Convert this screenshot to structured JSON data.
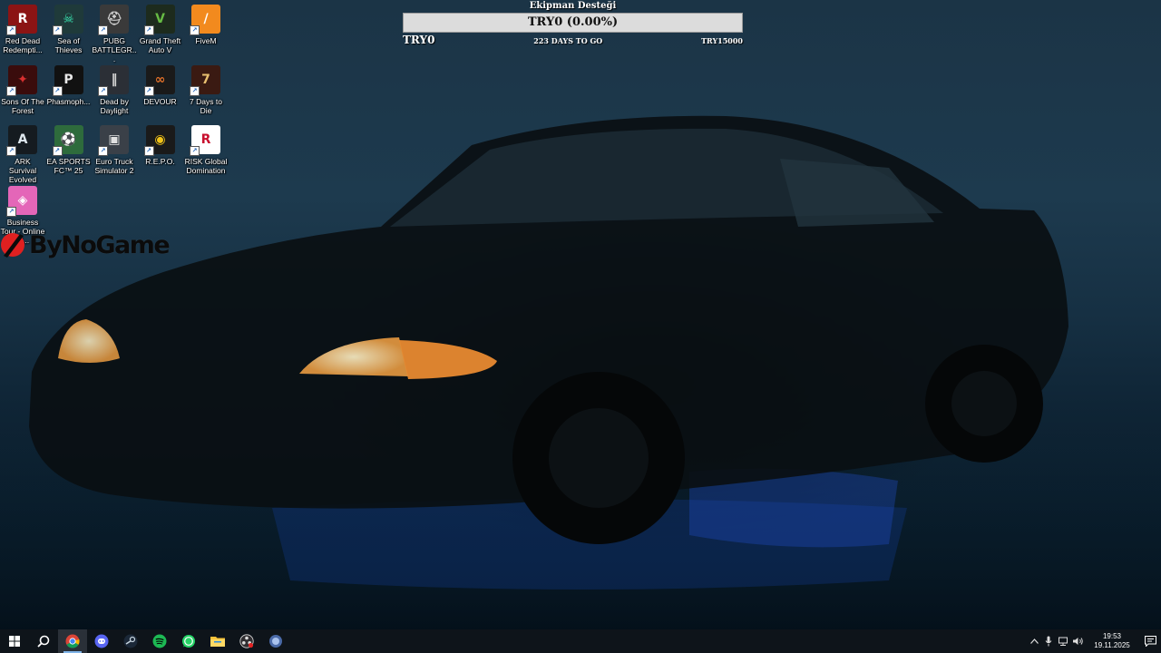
{
  "desktop": {
    "icons": [
      {
        "label": "Red Dead Redempti...",
        "glyph": "R",
        "bg": "#8b1414",
        "fg": "#ffffff",
        "icon": "red-dead-redemption-icon"
      },
      {
        "label": "Sea of Thieves",
        "glyph": "☠",
        "bg": "#1f3a3a",
        "fg": "#39e3b0",
        "icon": "sea-of-thieves-icon"
      },
      {
        "label": "PUBG BATTLEGR...",
        "glyph": "⛑",
        "bg": "#3a3a3a",
        "fg": "#d0d0d0",
        "icon": "pubg-icon"
      },
      {
        "label": "Grand Theft Auto V",
        "glyph": "V",
        "bg": "#1d2b1d",
        "fg": "#66bb44",
        "icon": "gta-v-icon"
      },
      {
        "label": "FiveM",
        "glyph": "/",
        "bg": "#f28a1e",
        "fg": "#ffffff",
        "icon": "fivem-icon"
      },
      {
        "label": "Sons Of The Forest",
        "glyph": "✦",
        "bg": "#3a0c0c",
        "fg": "#d83030",
        "icon": "sons-of-the-forest-icon"
      },
      {
        "label": "Phasmoph...",
        "glyph": "P",
        "bg": "#111111",
        "fg": "#e8e8e8",
        "icon": "phasmophobia-icon"
      },
      {
        "label": "Dead by Daylight",
        "glyph": "‖",
        "bg": "#2b2f36",
        "fg": "#d8d8d8",
        "icon": "dead-by-daylight-icon"
      },
      {
        "label": "DEVOUR",
        "glyph": "∞",
        "bg": "#1a1a1a",
        "fg": "#e0702a",
        "icon": "devour-icon"
      },
      {
        "label": "7 Days to Die",
        "glyph": "7",
        "bg": "#3a1a12",
        "fg": "#e8c070",
        "icon": "7-days-to-die-icon"
      },
      {
        "label": "ARK Survival Evolved",
        "glyph": "A",
        "bg": "#151b20",
        "fg": "#dfe8ee",
        "icon": "ark-icon"
      },
      {
        "label": "EA SPORTS FC™ 25",
        "glyph": "⚽",
        "bg": "#2e6b3c",
        "fg": "#ffffff",
        "icon": "ea-fc-25-icon"
      },
      {
        "label": "Euro Truck Simulator 2",
        "glyph": "▣",
        "bg": "#3a4048",
        "fg": "#e0e0e0",
        "icon": "euro-truck-simulator-icon"
      },
      {
        "label": "R.E.P.O.",
        "glyph": "◉",
        "bg": "#1a1a1a",
        "fg": "#f2c318",
        "icon": "repo-icon"
      },
      {
        "label": "RISK Global Domination",
        "glyph": "R",
        "bg": "#ffffff",
        "fg": "#c8102e",
        "icon": "risk-icon"
      },
      {
        "label": "Business Tour - Online M...",
        "glyph": "◈",
        "bg": "#e466b8",
        "fg": "#ffffff",
        "icon": "business-tour-icon"
      }
    ],
    "logo_text": "ByNoGame"
  },
  "goal_widget": {
    "title": "Ekipman Desteği",
    "bar_text": "TRY0 (0.00%)",
    "progress_percent": 0,
    "current": "TRY0",
    "days_left": "223 DAYS TO GO",
    "target": "TRY15000"
  },
  "taskbar": {
    "apps": [
      {
        "icon": "windows-start-icon",
        "active": false
      },
      {
        "icon": "search-icon",
        "active": false
      },
      {
        "icon": "chrome-icon",
        "active": true
      },
      {
        "icon": "discord-icon",
        "active": false
      },
      {
        "icon": "steam-icon",
        "active": false
      },
      {
        "icon": "spotify-icon",
        "active": false
      },
      {
        "icon": "whatsapp-icon",
        "active": false
      },
      {
        "icon": "file-explorer-icon",
        "active": false
      },
      {
        "icon": "obs-icon",
        "active": false
      },
      {
        "icon": "app-icon",
        "active": false
      }
    ],
    "clock_time": "19:53",
    "clock_date": "19.11.2025"
  }
}
